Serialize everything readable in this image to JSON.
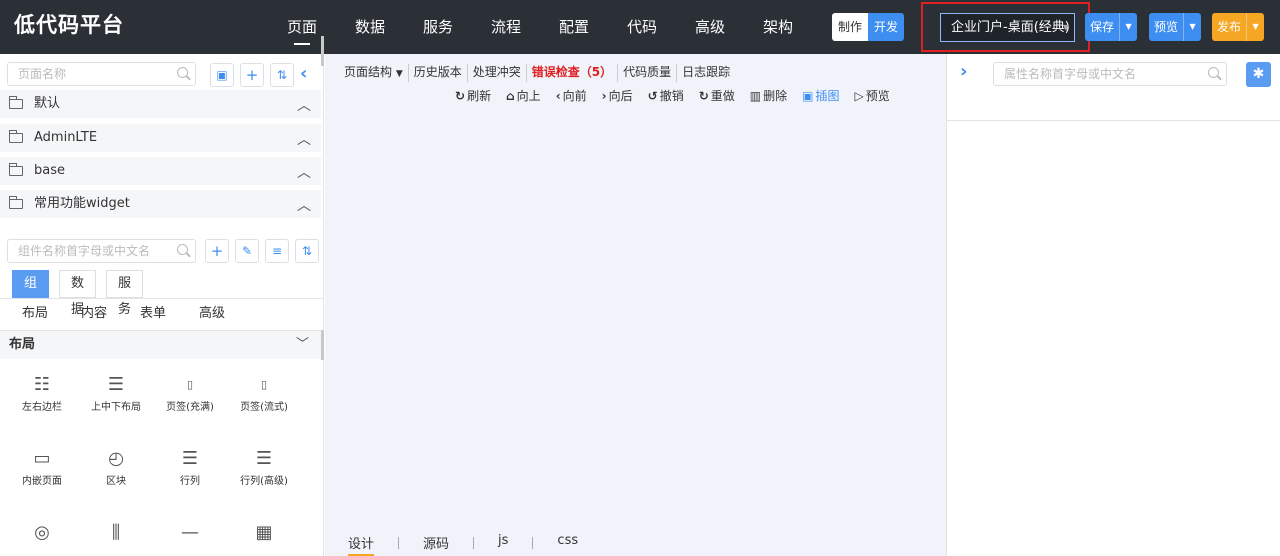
{
  "app": {
    "title": "低代码平台"
  },
  "nav": [
    "页面",
    "数据",
    "服务",
    "流程",
    "配置",
    "代码",
    "高级",
    "架构"
  ],
  "mode": {
    "make": "制作",
    "dev": "开发"
  },
  "project_select": {
    "value": "企业门户-桌面(经典)"
  },
  "actions": {
    "save": "保存",
    "preview": "预览",
    "publish": "发布"
  },
  "left": {
    "page_search_placeholder": "页面名称",
    "groups": [
      "默认",
      "AdminLTE",
      "base",
      "常用功能widget"
    ],
    "comp_search_placeholder": "组件名称首字母或中文名",
    "tabs": [
      "组件",
      "数据",
      "服务"
    ],
    "subtabs": [
      "布局",
      "内容",
      "表单",
      "高级"
    ],
    "category": "布局",
    "widgets": [
      "左右边栏",
      "上中下布局",
      "页签(充满)",
      "页签(流式)",
      "内嵌页面",
      "区块",
      "行列",
      "行列(高级)"
    ]
  },
  "center": {
    "tools1": [
      "页面结构",
      "历史版本",
      "处理冲突",
      "错误检查（5）",
      "代码质量",
      "日志跟踪"
    ],
    "tools2": [
      "刷新",
      "向上",
      "向前",
      "向后",
      "撤销",
      "重做",
      "删除",
      "插图",
      "预览"
    ],
    "bottom_tabs": [
      "设计",
      "源码",
      "js",
      "css"
    ]
  },
  "right": {
    "search_placeholder": "属性名称首字母或中文名"
  },
  "colors": {
    "topbar": "#2b2f36",
    "accent": "#3d8ef0",
    "publish": "#f5a623",
    "error": "#e02020"
  }
}
